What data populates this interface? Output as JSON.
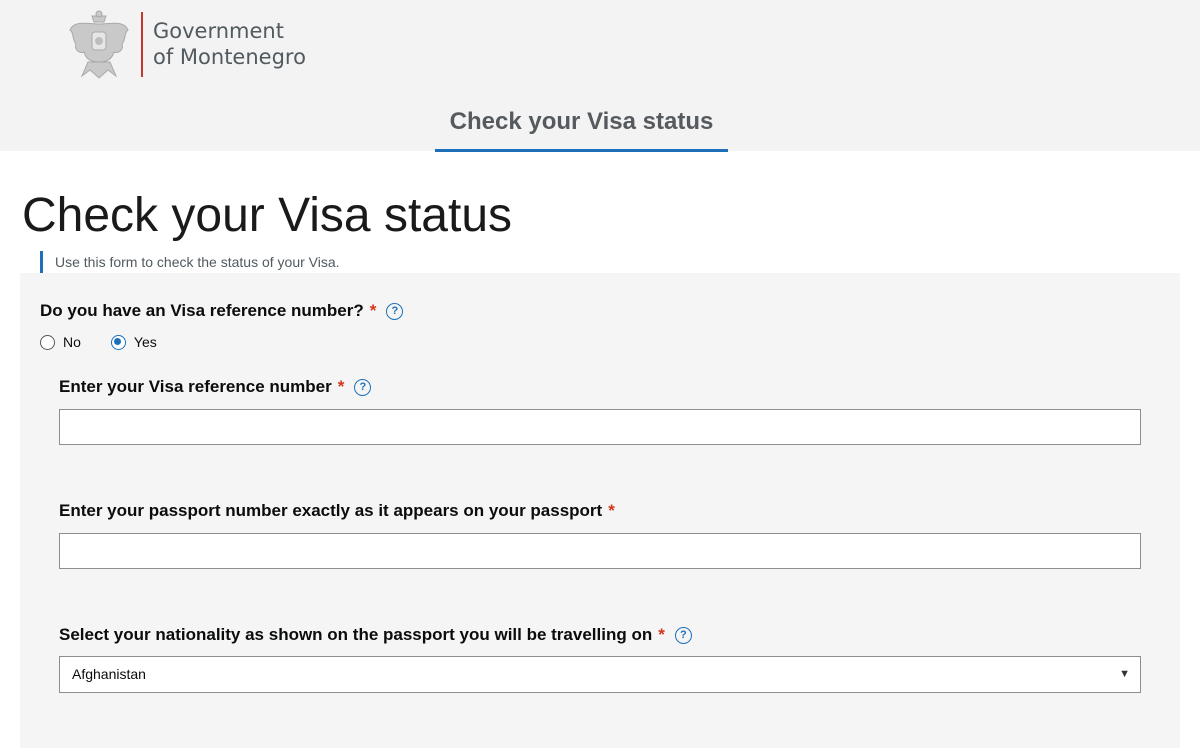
{
  "header": {
    "org_line1": "Government",
    "org_line2": "of Montenegro",
    "nav_tab": "Check your Visa status",
    "logo_icon": "coat-of-arms-icon"
  },
  "page": {
    "title": "Check your Visa status",
    "intro": "Use this form to check the status of your Visa."
  },
  "form": {
    "has_reference": {
      "label": "Do you have an Visa reference number?",
      "required": "*",
      "help": "?",
      "options": [
        {
          "label": "No",
          "selected": false
        },
        {
          "label": "Yes",
          "selected": true
        }
      ]
    },
    "reference_number": {
      "label": "Enter your Visa reference number",
      "required": "*",
      "help": "?",
      "value": ""
    },
    "passport_number": {
      "label": "Enter your passport number exactly as it appears on your passport",
      "required": "*",
      "value": ""
    },
    "nationality": {
      "label": "Select your nationality as shown on the passport you will be travelling on",
      "required": "*",
      "help": "?",
      "selected": "Afghanistan"
    }
  },
  "colors": {
    "accent": "#1d70b8",
    "required": "#d4351c",
    "header_bg": "#f3f3f3",
    "panel_bg": "#f5f5f5"
  }
}
